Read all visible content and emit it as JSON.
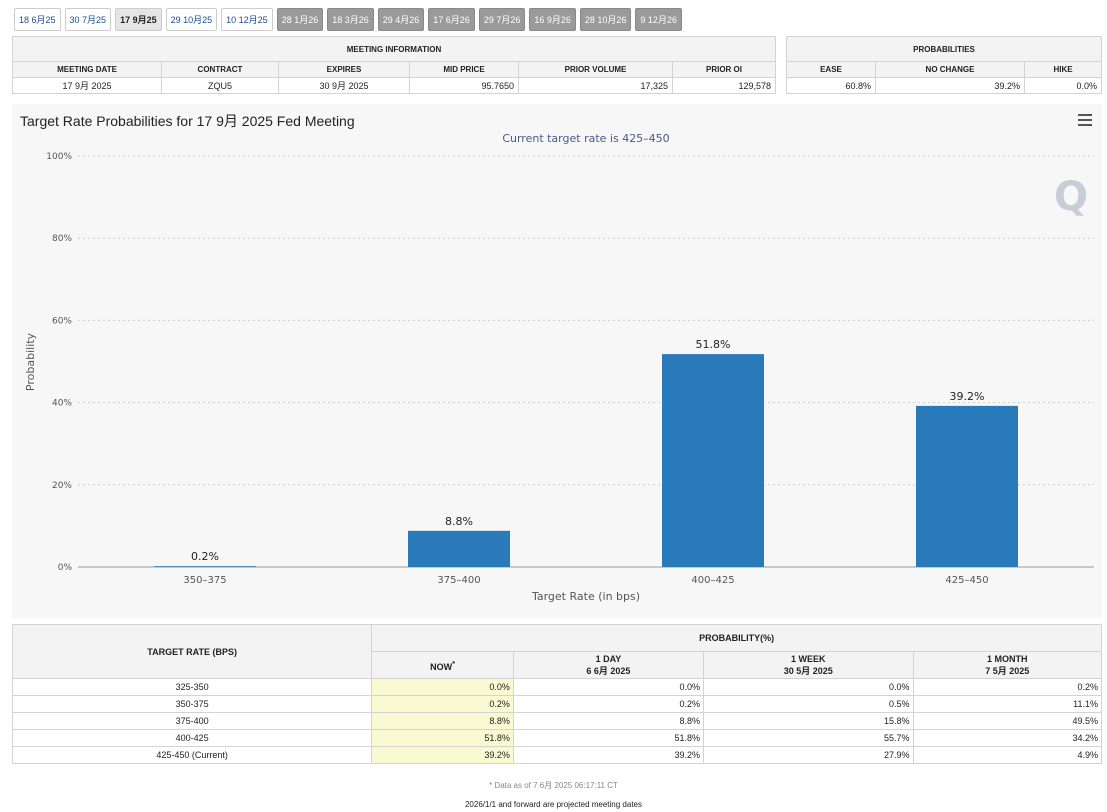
{
  "tabs": [
    {
      "label": "18 6月25",
      "state": "normal"
    },
    {
      "label": "30 7月25",
      "state": "normal"
    },
    {
      "label": "17 9月25",
      "state": "active"
    },
    {
      "label": "29 10月25",
      "state": "normal"
    },
    {
      "label": "10 12月25",
      "state": "normal"
    },
    {
      "label": "28 1月26",
      "state": "future"
    },
    {
      "label": "18 3月26",
      "state": "future"
    },
    {
      "label": "29 4月26",
      "state": "future"
    },
    {
      "label": "17 6月26",
      "state": "future"
    },
    {
      "label": "29 7月26",
      "state": "future"
    },
    {
      "label": "16 9月26",
      "state": "future"
    },
    {
      "label": "28 10月26",
      "state": "future"
    },
    {
      "label": "9 12月26",
      "state": "future"
    }
  ],
  "meeting_info": {
    "title": "MEETING INFORMATION",
    "headers": [
      "MEETING DATE",
      "CONTRACT",
      "EXPIRES",
      "MID PRICE",
      "PRIOR VOLUME",
      "PRIOR OI"
    ],
    "values": [
      "17 9月 2025",
      "ZQU5",
      "30 9月 2025",
      "95.7650",
      "17,325",
      "129,578"
    ]
  },
  "probabilities": {
    "title": "PROBABILITIES",
    "headers": [
      "EASE",
      "NO CHANGE",
      "HIKE"
    ],
    "values": [
      "60.8%",
      "39.2%",
      "0.0%"
    ]
  },
  "chart_title": "Target Rate Probabilities for 17 9月 2025 Fed Meeting",
  "chart_subtitle": "Current target rate is 425–450",
  "logo_text": "Q",
  "chart_data": {
    "type": "bar",
    "categories": [
      "350–375",
      "375–400",
      "400–425",
      "425–450"
    ],
    "values": [
      0.2,
      8.8,
      51.8,
      39.2
    ],
    "data_labels": [
      "0.2%",
      "8.8%",
      "51.8%",
      "39.2%"
    ],
    "xlabel": "Target Rate (in bps)",
    "ylabel": "Probability",
    "ylim": [
      0,
      100
    ],
    "yticks": [
      "0%",
      "20%",
      "40%",
      "60%",
      "80%",
      "100%"
    ],
    "bar_color": "#2a7ab9",
    "grid": true
  },
  "prob_table": {
    "row_header": "TARGET RATE (BPS)",
    "group_header": "PROBABILITY(%)",
    "columns": [
      {
        "label": "NOW",
        "sup": "*",
        "sub": ""
      },
      {
        "label": "1 DAY",
        "sub": "6 6月 2025"
      },
      {
        "label": "1 WEEK",
        "sub": "30 5月 2025"
      },
      {
        "label": "1 MONTH",
        "sub": "7 5月 2025"
      }
    ],
    "rows": [
      {
        "rate": "325-350",
        "vals": [
          "0.0%",
          "0.0%",
          "0.0%",
          "0.2%"
        ]
      },
      {
        "rate": "350-375",
        "vals": [
          "0.2%",
          "0.2%",
          "0.5%",
          "11.1%"
        ]
      },
      {
        "rate": "375-400",
        "vals": [
          "8.8%",
          "8.8%",
          "15.8%",
          "49.5%"
        ]
      },
      {
        "rate": "400-425",
        "vals": [
          "51.8%",
          "51.8%",
          "55.7%",
          "34.2%"
        ]
      },
      {
        "rate": "425-450 (Current)",
        "vals": [
          "39.2%",
          "39.2%",
          "27.9%",
          "4.9%"
        ]
      }
    ],
    "footnote": "* Data as of 7 6月 2025 06:17:11 CT",
    "projected_note": "2026/1/1 and forward are projected meeting dates"
  }
}
